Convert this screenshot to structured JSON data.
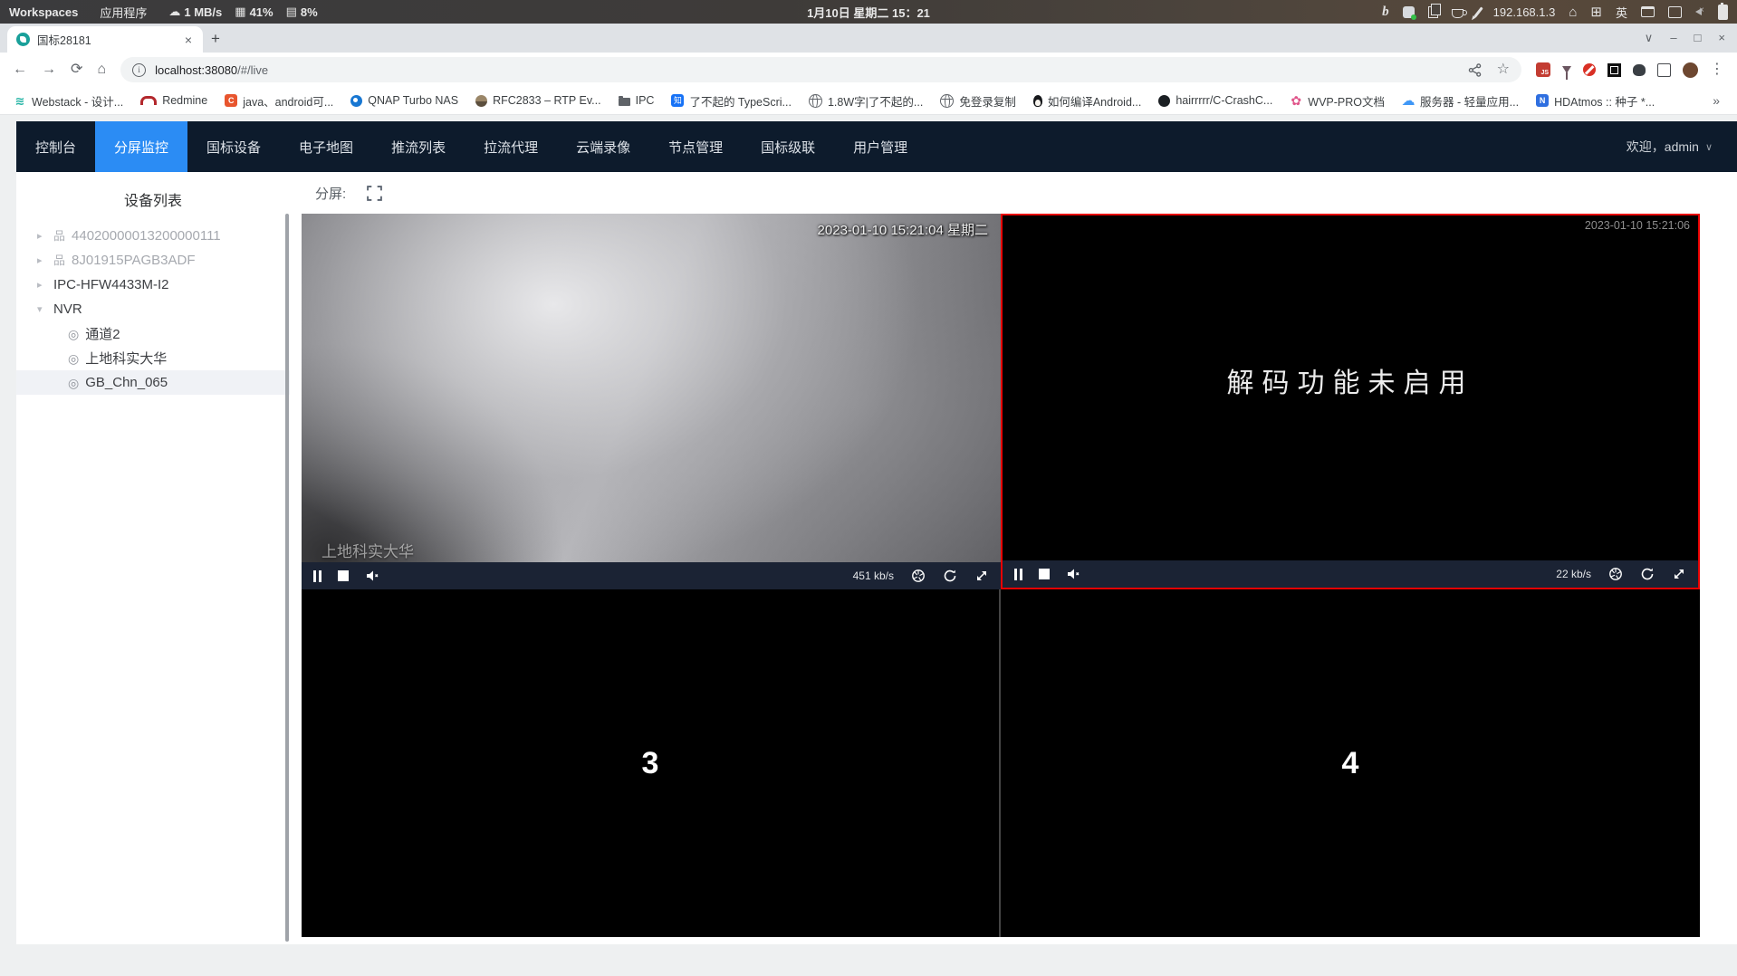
{
  "colors": {
    "accent": "#2b8cf4",
    "nav_background": "#0d1b2c",
    "selected_player_border": "#e80000",
    "player_bar_background": "#1b2334"
  },
  "icons": {
    "caret_collapsed": "▸",
    "caret_expanded": "▾",
    "tree_node": "品",
    "camera": "◎",
    "back": "←",
    "forward": "→",
    "reload": "⟳",
    "home": "⌂",
    "star": "☆",
    "kebab": "⋮",
    "overflow": "»",
    "tab_close": "×",
    "win_menu": "∨",
    "win_min": "–",
    "win_max": "□",
    "win_close": "×",
    "cloud_down": "☁",
    "cpu": "▦",
    "mem": "▤",
    "house": "⌂",
    "grid": "⊞",
    "dropdown": "∨",
    "new_tab": "+"
  },
  "system_bar": {
    "workspaces": "Workspaces",
    "applications": "应用程序",
    "net_speed": "1 MB/s",
    "cpu_usage": "41%",
    "mem_usage": "8%",
    "datetime": "1月10日 星期二 15：21",
    "ip": "192.168.1.3",
    "input_method": "英"
  },
  "browser": {
    "tab_title": "国标28181",
    "url_host": "localhost:38080",
    "url_path": "/#/live",
    "bookmarks": [
      {
        "label": "Webstack - 设计..."
      },
      {
        "label": "Redmine"
      },
      {
        "label": "java、android可..."
      },
      {
        "label": "QNAP Turbo NAS"
      },
      {
        "label": "RFC2833 – RTP Ev..."
      },
      {
        "label": "IPC"
      },
      {
        "label": "了不起的 TypeScri..."
      },
      {
        "label": "1.8W字|了不起的..."
      },
      {
        "label": "免登录复制"
      },
      {
        "label": "如何编译Android..."
      },
      {
        "label": "hairrrrr/C-CrashC..."
      },
      {
        "label": "WVP-PRO文档"
      },
      {
        "label": "服务器 - 轻量应用..."
      },
      {
        "label": "HDAtmos :: 种子 *..."
      }
    ]
  },
  "nav": {
    "items": [
      {
        "label": "控制台"
      },
      {
        "label": "分屏监控"
      },
      {
        "label": "国标设备"
      },
      {
        "label": "电子地图"
      },
      {
        "label": "推流列表"
      },
      {
        "label": "拉流代理"
      },
      {
        "label": "云端录像"
      },
      {
        "label": "节点管理"
      },
      {
        "label": "国标级联"
      },
      {
        "label": "用户管理"
      }
    ],
    "active": "分屏监控",
    "welcome": "欢迎，admin"
  },
  "sidebar": {
    "title": "设备列表",
    "devices": [
      {
        "label": "44020000013200000111"
      },
      {
        "label": "8J01915PAGB3ADF"
      },
      {
        "label": "IPC-HFW4433M-I2"
      },
      {
        "label": "NVR"
      }
    ],
    "channels": [
      {
        "label": "通道2"
      },
      {
        "label": "上地科实大华"
      },
      {
        "label": "GB_Chn_065"
      }
    ]
  },
  "toolbar": {
    "split_label": "分屏:"
  },
  "players": {
    "p1": {
      "timestamp": "2023-01-10 15:21:04 星期二",
      "watermark": "上地科实大华",
      "bitrate": "451 kb/s"
    },
    "p2": {
      "timestamp": "2023-01-10 15:21:06",
      "message": "解码功能未启用",
      "bitrate": "22 kb/s"
    },
    "p3": {
      "number": "3"
    },
    "p4": {
      "number": "4"
    }
  }
}
